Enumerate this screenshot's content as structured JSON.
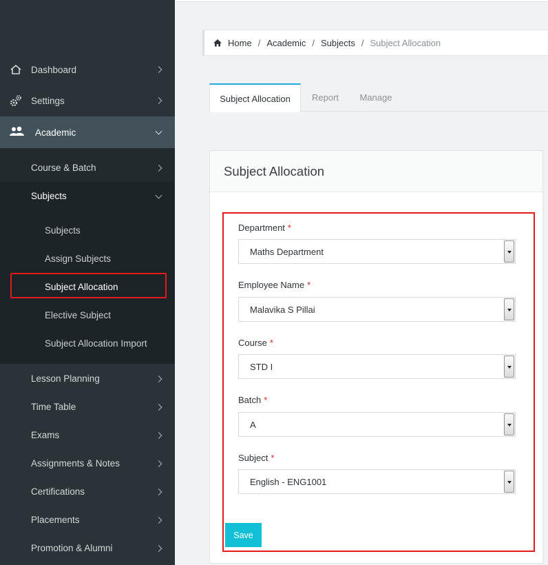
{
  "sidebar": {
    "items": [
      {
        "label": "Dashboard",
        "icon": "home-icon"
      },
      {
        "label": "Settings",
        "icon": "gears-icon"
      },
      {
        "label": "Academic",
        "icon": "users-icon"
      }
    ],
    "academic_children": {
      "course_batch": "Course & Batch",
      "subjects": "Subjects"
    },
    "subjects_children": [
      "Subjects",
      "Assign Subjects",
      "Subject Allocation",
      "Elective Subject",
      "Subject Allocation Import"
    ],
    "more_items": [
      "Lesson Planning",
      "Time Table",
      "Exams",
      "Assignments & Notes",
      "Certifications",
      "Placements",
      "Promotion & Alumni"
    ]
  },
  "breadcrumb": {
    "home": "Home",
    "academic": "Academic",
    "subjects": "Subjects",
    "current": "Subject Allocation",
    "separator": "/"
  },
  "tabs": [
    "Subject Allocation",
    "Report",
    "Manage"
  ],
  "panel": {
    "title": "Subject Allocation"
  },
  "form": {
    "required_mark": "*",
    "department": {
      "label": "Department",
      "value": "Maths Department"
    },
    "employee": {
      "label": "Employee Name",
      "value": "Malavika S Pillai"
    },
    "course": {
      "label": "Course",
      "value": "STD I"
    },
    "batch": {
      "label": "Batch",
      "value": "A"
    },
    "subject": {
      "label": "Subject",
      "value": "English - ENG1001"
    },
    "save_label": "Save"
  },
  "colors": {
    "sidebar_bg": "#2a3338",
    "active_section": "#43525a",
    "accent": "#21a7d8",
    "save_button": "#12c0d6",
    "highlight": "#e41a1a"
  }
}
